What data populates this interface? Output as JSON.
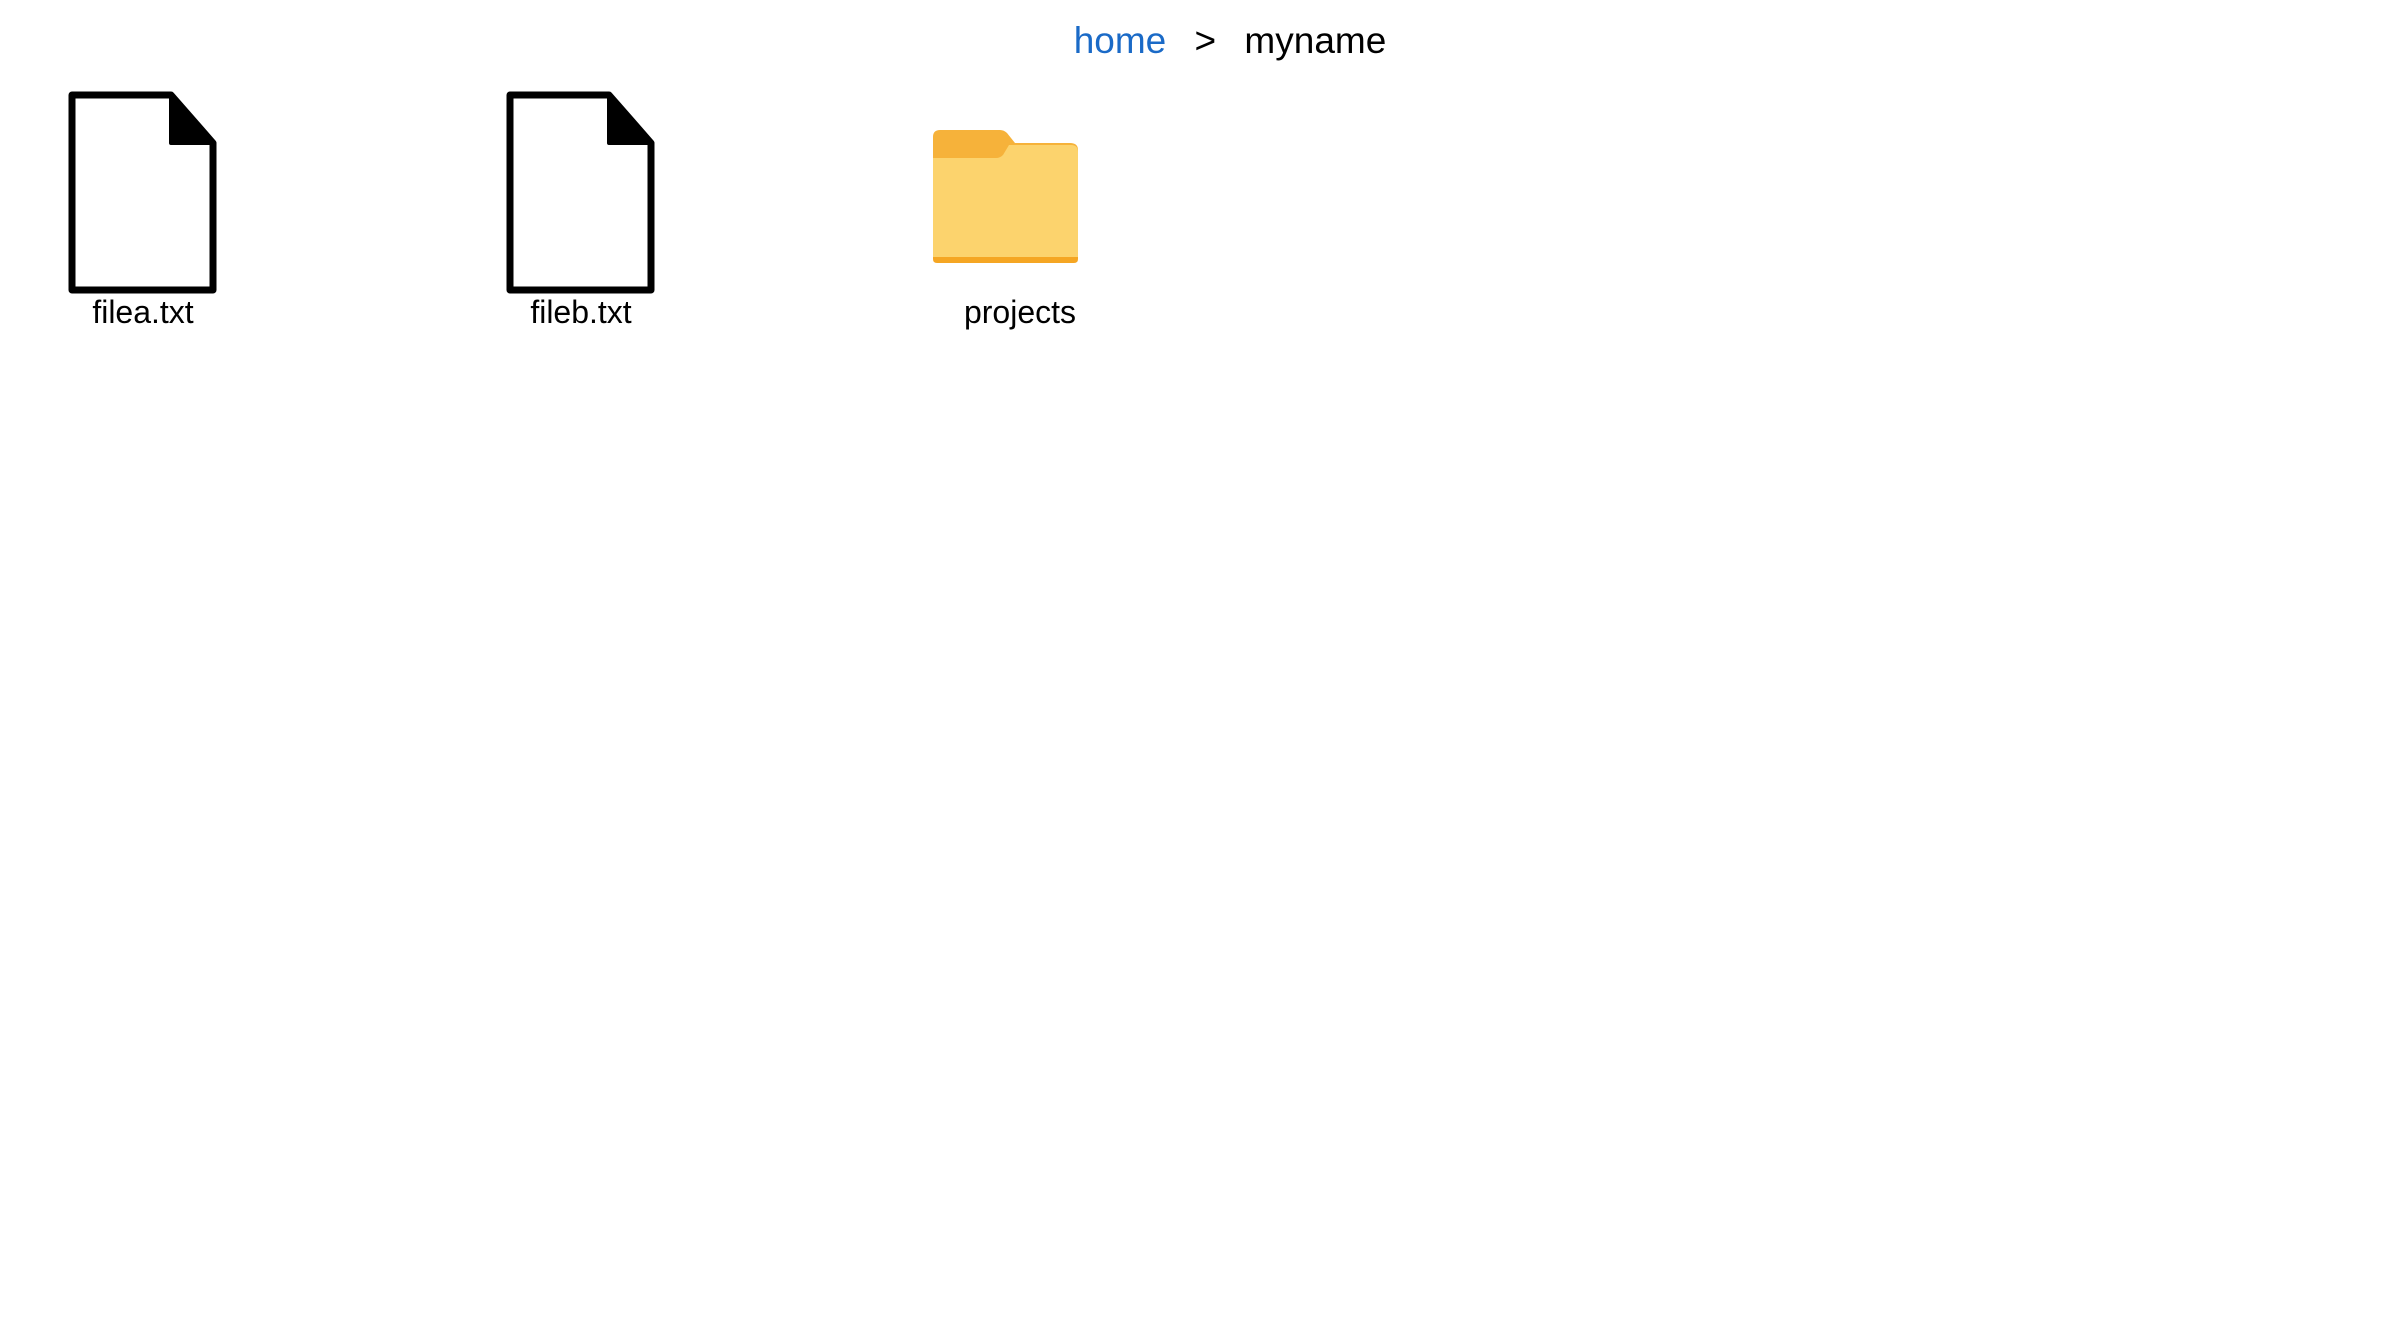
{
  "breadcrumb": {
    "items": [
      "home",
      "myname"
    ],
    "separator": ">"
  },
  "files": [
    {
      "name": "filea.txt",
      "type": "file",
      "icon": "document-icon"
    },
    {
      "name": "fileb.txt",
      "type": "file",
      "icon": "document-icon"
    },
    {
      "name": "projects",
      "type": "folder",
      "icon": "folder-icon"
    }
  ],
  "colors": {
    "link": "#1a6ac7",
    "folder_front": "#fcd36d",
    "folder_tab": "#f6b23a",
    "folder_bottom": "#f5a623",
    "document_stroke": "#000000"
  }
}
